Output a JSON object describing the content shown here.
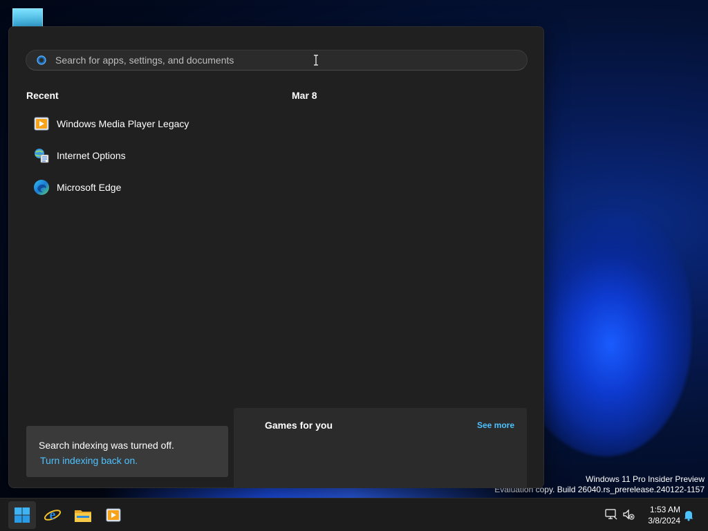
{
  "search": {
    "placeholder": "Search for apps, settings, and documents",
    "value": ""
  },
  "recent": {
    "heading": "Recent",
    "items": [
      {
        "label": "Windows Media Player Legacy",
        "icon": "windows-media-player-icon"
      },
      {
        "label": "Internet Options",
        "icon": "internet-options-icon"
      },
      {
        "label": "Microsoft Edge",
        "icon": "microsoft-edge-icon"
      }
    ]
  },
  "date_heading": "Mar 8",
  "indexing": {
    "message": "Search indexing was turned off.",
    "link": "Turn indexing back on."
  },
  "games": {
    "title": "Games for you",
    "see_more": "See more"
  },
  "watermark": {
    "line1": "Windows 11 Pro Insider Preview",
    "line2": "Evaluation copy. Build 26040.rs_prerelease.240122-1157"
  },
  "taskbar": {
    "apps": [
      {
        "icon": "windows-start-icon"
      },
      {
        "icon": "internet-explorer-icon"
      },
      {
        "icon": "file-explorer-icon"
      },
      {
        "icon": "windows-media-player-icon"
      }
    ],
    "tray_icons": [
      "network-icon",
      "sound-muted-icon",
      "notification-bell-icon"
    ],
    "clock": {
      "time": "1:53 AM",
      "date": "3/8/2024"
    }
  },
  "colors": {
    "panel_bg": "#202020",
    "accent_link": "#4cc2ff",
    "taskbar_bg": "#1c1c1c"
  }
}
